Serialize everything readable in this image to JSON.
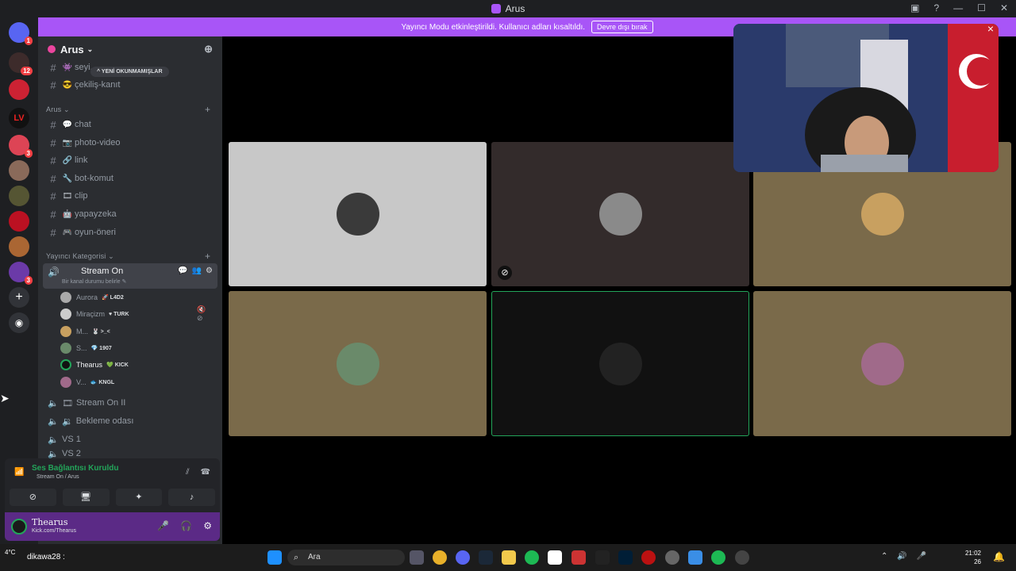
{
  "window": {
    "title": "Arus",
    "icons": [
      "help-icon",
      "inbox-icon",
      "minimize-icon",
      "maximize-icon",
      "close-icon"
    ]
  },
  "banner": {
    "text": "Yayıncı Modu etkinleştirildi. Kullanıcı adları kısaltıldı.",
    "button": "Devre dışı bırak",
    "close": "×"
  },
  "servers": {
    "badges": [
      "1",
      "12",
      "3",
      "3"
    ]
  },
  "server": {
    "name": "Arus"
  },
  "unread_pill": "^ YENİ OKUNMAMIŞLAR",
  "top_channels": [
    {
      "name": "seyi...",
      "icon": "👾"
    },
    {
      "name": "çekiliş-kanıt",
      "icon": "😎"
    }
  ],
  "categories": {
    "arus": "Arus ⌄",
    "yayinci": "Yayıncı Kategorisi ⌄"
  },
  "channels": [
    {
      "name": "chat",
      "icon": "💬"
    },
    {
      "name": "photo-video",
      "icon": "📷"
    },
    {
      "name": "link",
      "icon": "🔗"
    },
    {
      "name": "bot-komut",
      "icon": "🔧"
    },
    {
      "name": "clip",
      "icon": "🎞"
    },
    {
      "name": "yapayzeka",
      "icon": "🤖"
    },
    {
      "name": "oyun-öneri",
      "icon": "🎮"
    }
  ],
  "voice_active": {
    "name": "Stream On",
    "status": "Bir kanal durumu belirle ✎"
  },
  "voice_users": [
    {
      "name": "Aurora",
      "tag": "🚀 L4D2"
    },
    {
      "name": "Miraçizm",
      "tag": "♥ TURK"
    },
    {
      "name": "M...",
      "tag": "🐰 >_<"
    },
    {
      "name": "S...",
      "tag": "💎 1907"
    },
    {
      "name": "Thearus",
      "tag": "💚 KICK"
    },
    {
      "name": "V...",
      "tag": "🐟 KNGL"
    }
  ],
  "voice_channels": [
    "Stream On II",
    "Bekleme odası",
    "VS 1",
    "VS 2"
  ],
  "connection": {
    "title": "Ses Bağlantısı Kuruldu",
    "sub": "Stream On / Arus"
  },
  "user": {
    "name": "Thearus",
    "status": "Kick.com/Thearus"
  },
  "tiles": [
    {
      "bg": "#c8c8c8",
      "avatar": "#3a3a3a"
    },
    {
      "bg": "#332b2b",
      "avatar": "#8a8a8a",
      "muted": true
    },
    {
      "bg": "#7a6a4a",
      "avatar": "#c8a060"
    },
    {
      "bg": "#7a6a4a",
      "avatar": "#6a8a6a"
    },
    {
      "bg": "#111111",
      "avatar": "#222222",
      "speaking": true
    },
    {
      "bg": "#7a6a4a",
      "avatar": "#a06a8a"
    }
  ],
  "taskbar": {
    "search": "Ara",
    "weather": "4°C",
    "user": "dikawa28 :",
    "time": "21:02",
    "date": "26"
  },
  "colors": {
    "accent": "#a855f7",
    "online": "#23a55a",
    "sidebar": "#2b2d31"
  }
}
